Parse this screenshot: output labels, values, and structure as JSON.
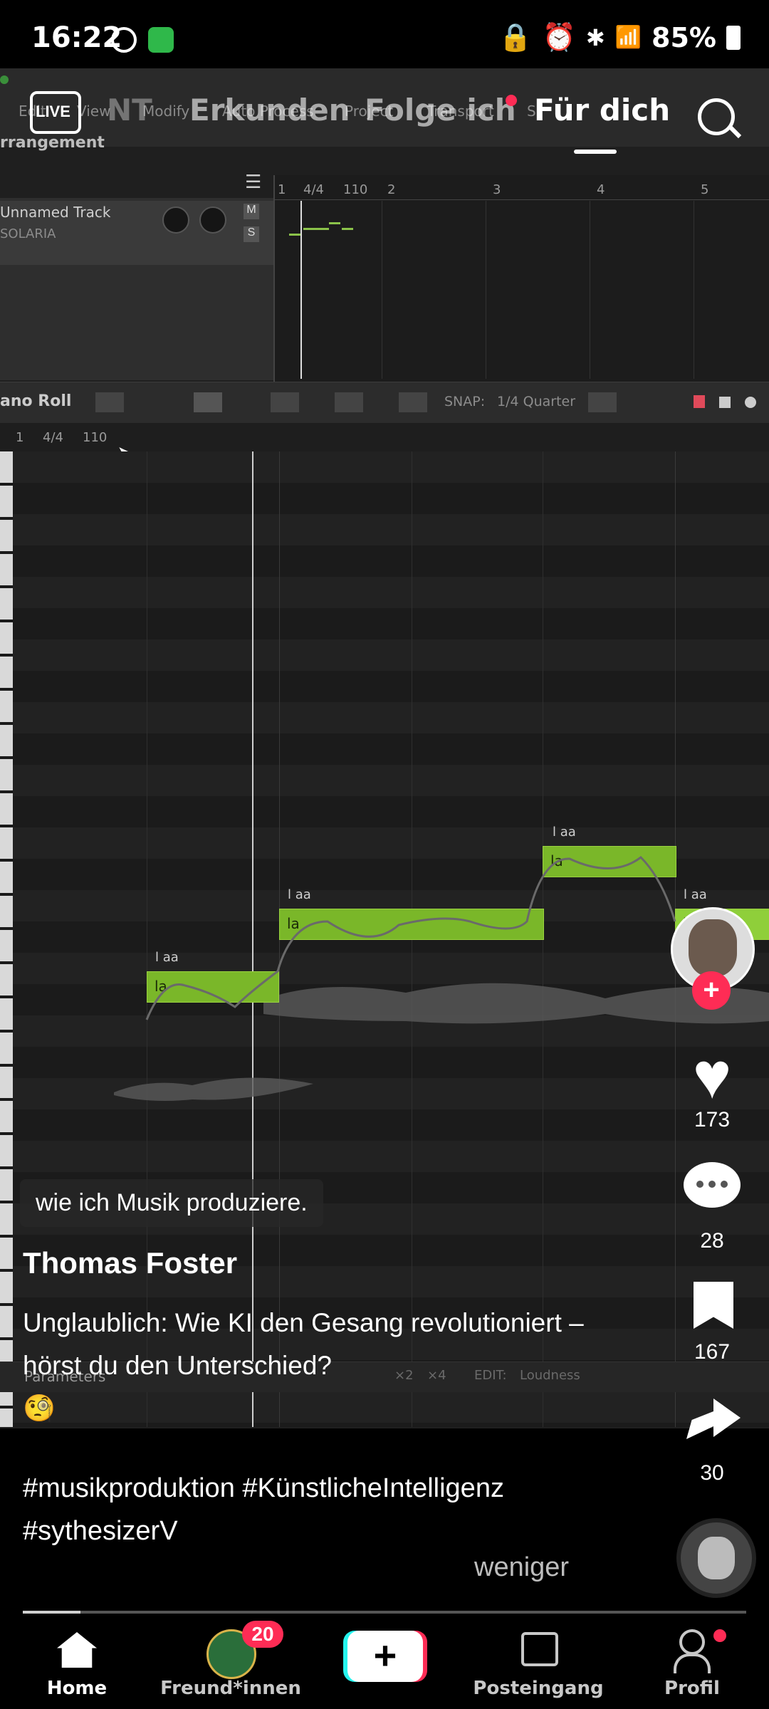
{
  "status_bar": {
    "time": "16:22",
    "battery": "85%"
  },
  "tabs": [
    {
      "label": "LIVE"
    },
    {
      "label": "NT"
    },
    {
      "label": "Erkunden"
    },
    {
      "label": "Folge ich"
    },
    {
      "label": "Für dich"
    }
  ],
  "daw": {
    "menu": [
      "Edit",
      "View",
      "Modify",
      "Auto Process",
      "Project",
      "Transport",
      "S"
    ],
    "arrangement_label": "rrangement",
    "track_name": "Unnamed Track",
    "track_voice": "SOLARIA",
    "track_m": "M",
    "track_s": "S",
    "arr_ruler": [
      "1",
      "4/4",
      "110",
      "2",
      "3",
      "4",
      "5"
    ],
    "piano_roll_label": "ano Roll",
    "snap_label": "SNAP:",
    "snap_value": "1/4 Quarter",
    "roll_ruler": [
      "1",
      "4/4",
      "110"
    ],
    "notes": [
      {
        "lyric": "la",
        "phoneme": "l aa"
      },
      {
        "lyric": "la",
        "phoneme": "l aa"
      },
      {
        "lyric": "la",
        "phoneme": "l aa"
      },
      {
        "lyric": "la",
        "phoneme": "l aa"
      }
    ],
    "params_label": "Parameters",
    "params_x2": "×2",
    "params_x4": "×4",
    "params_edit": "EDIT:",
    "params_edit_value": "Loudness"
  },
  "post": {
    "caption_bubble": "wie ich Musik produziere.",
    "author": "Thomas Foster",
    "description": "Unglaublich: Wie KI den Gesang revolutioniert – hörst du den Unterschied?",
    "emoji": "🧐",
    "hashtags": "#musikproduktion #KünstlicheIntelligenz #sythesizerV",
    "less_label": "weniger",
    "progress": 0.08
  },
  "actions": {
    "likes": "173",
    "comments": "28",
    "saves": "167",
    "shares": "30"
  },
  "nav": {
    "home": "Home",
    "friends": "Freund*innen",
    "friends_badge": "20",
    "inbox": "Posteingang",
    "profile": "Profil"
  },
  "colors": {
    "note_green": "#7ab729",
    "like_red": "#fe2c55",
    "cyan": "#25f4ee"
  }
}
